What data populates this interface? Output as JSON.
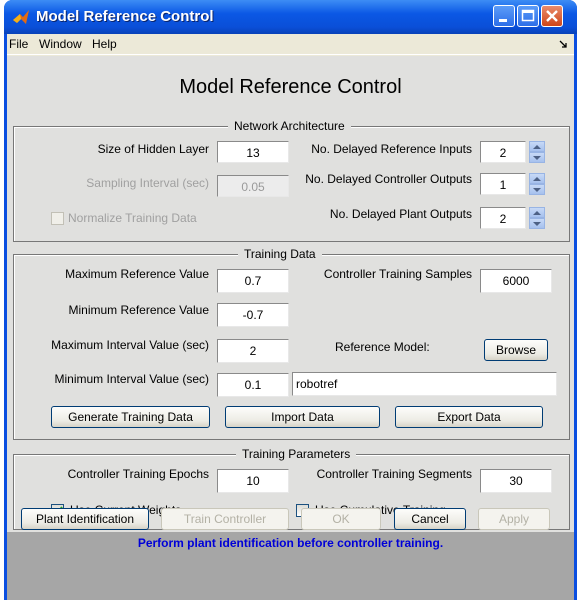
{
  "window": {
    "title": "Model Reference Control"
  },
  "menu": [
    "File",
    "Window",
    "Help"
  ],
  "heading": "Model Reference Control",
  "network_architecture": {
    "legend": "Network Architecture",
    "hidden_layer_label": "Size of Hidden Layer",
    "hidden_layer_value": "13",
    "sampling_label": "Sampling Interval (sec)",
    "sampling_value": "0.05",
    "normalize_label": "Normalize Training Data",
    "normalize_checked": false,
    "delayed_ref_label": "No. Delayed Reference Inputs",
    "delayed_ref_value": "2",
    "delayed_ctrl_label": "No. Delayed Controller Outputs",
    "delayed_ctrl_value": "1",
    "delayed_plant_label": "No. Delayed Plant Outputs",
    "delayed_plant_value": "2"
  },
  "training_data": {
    "legend": "Training Data",
    "max_ref_label": "Maximum Reference Value",
    "max_ref_value": "0.7",
    "min_ref_label": "Minimum Reference Value",
    "min_ref_value": "-0.7",
    "max_int_label": "Maximum Interval Value (sec)",
    "max_int_value": "2",
    "min_int_label": "Minimum Interval Value (sec)",
    "min_int_value": "0.1",
    "samples_label": "Controller Training Samples",
    "samples_value": "6000",
    "ref_model_label": "Reference Model:",
    "browse_label": "Browse",
    "ref_model_value": "robotref",
    "generate_label": "Generate Training Data",
    "import_label": "Import Data",
    "export_label": "Export Data"
  },
  "training_params": {
    "legend": "Training Parameters",
    "epochs_label": "Controller Training Epochs",
    "epochs_value": "10",
    "segments_label": "Controller Training Segments",
    "segments_value": "30",
    "use_current_label": "Use Current Weights",
    "use_current_checked": true,
    "use_cumulative_label": "Use Cumulative Training",
    "use_cumulative_checked": false
  },
  "buttons": {
    "plant_id": "Plant Identification",
    "train_ctrl": "Train Controller",
    "ok": "OK",
    "cancel": "Cancel",
    "apply": "Apply"
  },
  "status": "Perform plant identification before controller training.",
  "colors": {
    "titlebar": "#0a4ee0",
    "status_text": "#0000d8",
    "status_bg": "#a6a6a6"
  }
}
